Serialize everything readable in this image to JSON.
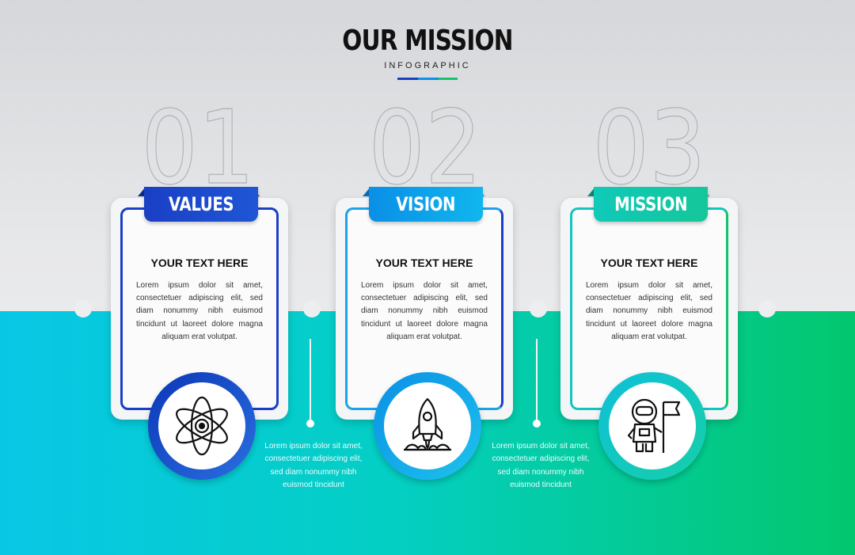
{
  "header": {
    "title": "OUR MISSION",
    "subtitle": "INFOGRAPHIC"
  },
  "colors": {
    "blue": "#1a3fc4",
    "sky": "#0a8fe6",
    "teal": "#10c9b8",
    "green": "#12c36a"
  },
  "steps": [
    {
      "number": "01",
      "label": "VALUES",
      "heading": "YOUR TEXT HERE",
      "body": "Lorem ipsum dolor sit amet, consectetuer adipiscing elit, sed diam nonummy nibh euismod tincidunt ut laoreet dolore magna aliquam erat volutpat.",
      "icon": "atom-icon"
    },
    {
      "number": "02",
      "label": "VISION",
      "heading": "YOUR TEXT HERE",
      "body": "Lorem ipsum dolor sit amet, consectetuer adipiscing elit, sed diam nonummy nibh euismod tincidunt ut laoreet dolore magna aliquam erat volutpat.",
      "icon": "rocket-icon"
    },
    {
      "number": "03",
      "label": "MISSION",
      "heading": "YOUR TEXT HERE",
      "body": "Lorem ipsum dolor sit amet, consectetuer adipiscing elit, sed diam nonummy nibh euismod tincidunt ut laoreet dolore magna aliquam erat volutpat.",
      "icon": "astronaut-flag-icon"
    }
  ],
  "captions": [
    "Lorem ipsum dolor sit amet, consectetuer adipiscing elit, sed diam nonummy nibh euismod tincidunt",
    "Lorem ipsum dolor sit amet, consectetuer adipiscing elit, sed diam nonummy nibh euismod tincidunt"
  ]
}
